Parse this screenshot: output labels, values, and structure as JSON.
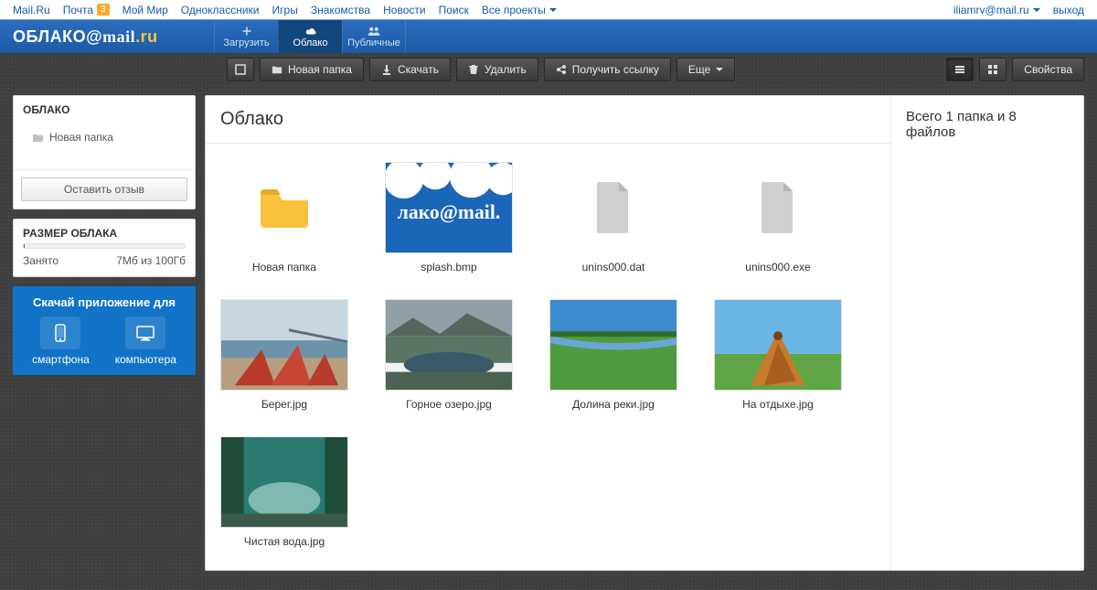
{
  "portal": {
    "links": [
      "Mail.Ru",
      "Почта",
      "Мой Мир",
      "Одноклассники",
      "Игры",
      "Знакомства",
      "Новости",
      "Поиск",
      "Все проекты"
    ],
    "mail_badge": "3",
    "user_email": "iliamrv@mail.ru",
    "logout": "выход"
  },
  "header": {
    "logo_oblako": "ОБЛАКО",
    "logo_mail": "mail",
    "logo_ru": ".ru",
    "tabs": [
      {
        "label": "Загрузить",
        "icon": "plus"
      },
      {
        "label": "Облако",
        "icon": "cloud",
        "active": true
      },
      {
        "label": "Публичные",
        "icon": "people"
      }
    ]
  },
  "toolbar": {
    "new_folder": "Новая папка",
    "download": "Скачать",
    "delete": "Удалить",
    "get_link": "Получить ссылку",
    "more": "Еще",
    "properties": "Свойства"
  },
  "sidebar": {
    "title": "ОБЛАКО",
    "items": [
      {
        "label": "Новая папка"
      }
    ],
    "feedback_label": "Оставить отзыв",
    "size_title": "РАЗМЕР ОБЛАКА",
    "used_label": "Занято",
    "used_value": "7Мб из 100Гб",
    "promo_title": "Скачай приложение для",
    "promo_phone": "смартфона",
    "promo_pc": "компьютера"
  },
  "content": {
    "title": "Облако",
    "items": [
      {
        "name": "Новая папка",
        "type": "folder"
      },
      {
        "name": "splash.bmp",
        "type": "image-splash"
      },
      {
        "name": "unins000.dat",
        "type": "file"
      },
      {
        "name": "unins000.exe",
        "type": "file"
      },
      {
        "name": "Берег.jpg",
        "type": "image-beach"
      },
      {
        "name": "Горное озеро.jpg",
        "type": "image-mlake"
      },
      {
        "name": "Долина реки.jpg",
        "type": "image-valley"
      },
      {
        "name": "На отдыхе.jpg",
        "type": "image-vac"
      },
      {
        "name": "Чистая вода.jpg",
        "type": "image-water"
      }
    ]
  },
  "info": {
    "summary": "Всего 1 папка и 8 файлов"
  }
}
